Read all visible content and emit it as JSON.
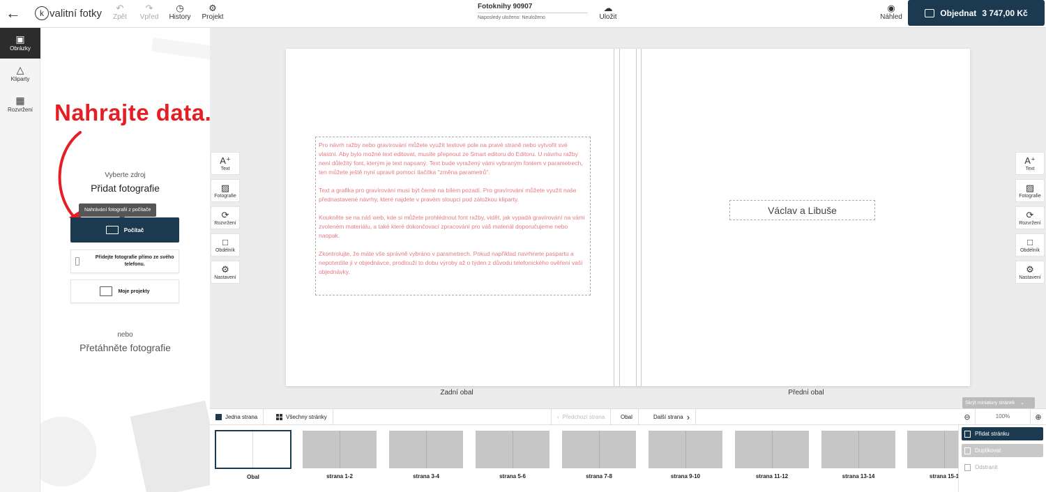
{
  "topbar": {
    "back_icon": "←",
    "logo_mark": "k",
    "logo_text": "valitní fotky",
    "undo": {
      "label": "Zpět",
      "icon": "↶"
    },
    "redo": {
      "label": "Vpřed",
      "icon": "↷"
    },
    "history": {
      "label": "History",
      "icon": "◷"
    },
    "project": {
      "label": "Projekt",
      "icon": "⚙"
    },
    "doc_title": "Fotoknihy 90907",
    "saved_prefix": "Naposledy uloženo:",
    "saved_value": "Neuloženo",
    "save": {
      "label": "Uložit",
      "icon": "☁"
    },
    "preview": {
      "label": "Náhled",
      "icon": "◉"
    },
    "order_label": "Objednat",
    "order_price": "3 747,00 Kč"
  },
  "rail": [
    {
      "label": "Obrázky",
      "icon": "▣"
    },
    {
      "label": "Kliparty",
      "icon": "△"
    },
    {
      "label": "Rozvržení",
      "icon": "▦"
    }
  ],
  "panel": {
    "annotation": "Nahrajte data.",
    "source_label": "Vyberte zdroj",
    "source_title": "Přidat fotografie",
    "tooltip": "Nahrávání fotografií z počítače",
    "computer_btn": "Počítač",
    "phone_btn": "Přidejte fotografie přímo ze svého telefonu.",
    "projects_btn": "Moje projekty",
    "or_label": "nebo",
    "drag_title": "Přetáhněte fotografie"
  },
  "tools": [
    {
      "label": "Text",
      "icon": "A⁺"
    },
    {
      "label": "Fotografie",
      "icon": "▨"
    },
    {
      "label": "Rozvržení",
      "icon": "⟳"
    },
    {
      "label": "Obdélník",
      "icon": "□"
    },
    {
      "label": "Nastavení",
      "icon": "⚙"
    }
  ],
  "spread": {
    "back_text": [
      "Pro návrh ražby nebo gravírování můžete využít textové pole na pravé straně nebo vytvořit své vlastní. Aby bylo možné text editovat, musíte přepnout ze Smart editoru do Editoru. U návrhu ražby není důležitý font, kterým je text napsaný. Text bude vyražený vámi vybraným fontem v parametrech, ten můžete ještě nyní upravit pomocí tlačítka \"změna parametrů\".",
      "Text a grafika pro gravírování musí být černé na bílém pozadí. Pro gravírování můžete využít naše přednastavené návrhy, které najdete v pravém sloupci pod záložkou kliparty.",
      "Koukněte se na náš web, kde si můžete prohlédnout font ražby, vidět, jak vypadá gravírování na vámi zvoleném materiálu, a také které dokončovací zpracování pro váš materiál doporučujeme nebo naopak.",
      "Zkontrolujte, že máte vše správně vybráno v parametrech. Pokud například navrhnete paspartu a nepotvrdíte ji v objednávce, prodlouží to dobu výroby až o týden z důvodu telefonického ověření vaší objednávky."
    ],
    "front_text": "Václav a Libuše",
    "back_label": "Zadní obal",
    "front_label": "Přední obal"
  },
  "bottombar": {
    "single_page": "Jedna strana",
    "all_pages": "Všechny stránky",
    "prev_page": "Předchozí strana",
    "current": "Obal",
    "next_page": "Další strana",
    "zoom": "100%",
    "zoom_out_icon": "⊖",
    "zoom_in_icon": "⊕",
    "hide_thumbs": "Skrýt miniatury stránek"
  },
  "thumbnails": [
    "Obal",
    "strana 1-2",
    "strana 3-4",
    "strana 5-6",
    "strana 7-8",
    "strana 9-10",
    "strana 11-12",
    "strana 13-14",
    "strana 15-1"
  ],
  "page_menu": {
    "add": "Přidat stránku",
    "duplicate": "Duplikovat",
    "remove": "Odstranit"
  },
  "colors": {
    "primary": "#1c3a4f",
    "annotation": "#e31e24",
    "hint_text": "#e67a80"
  }
}
